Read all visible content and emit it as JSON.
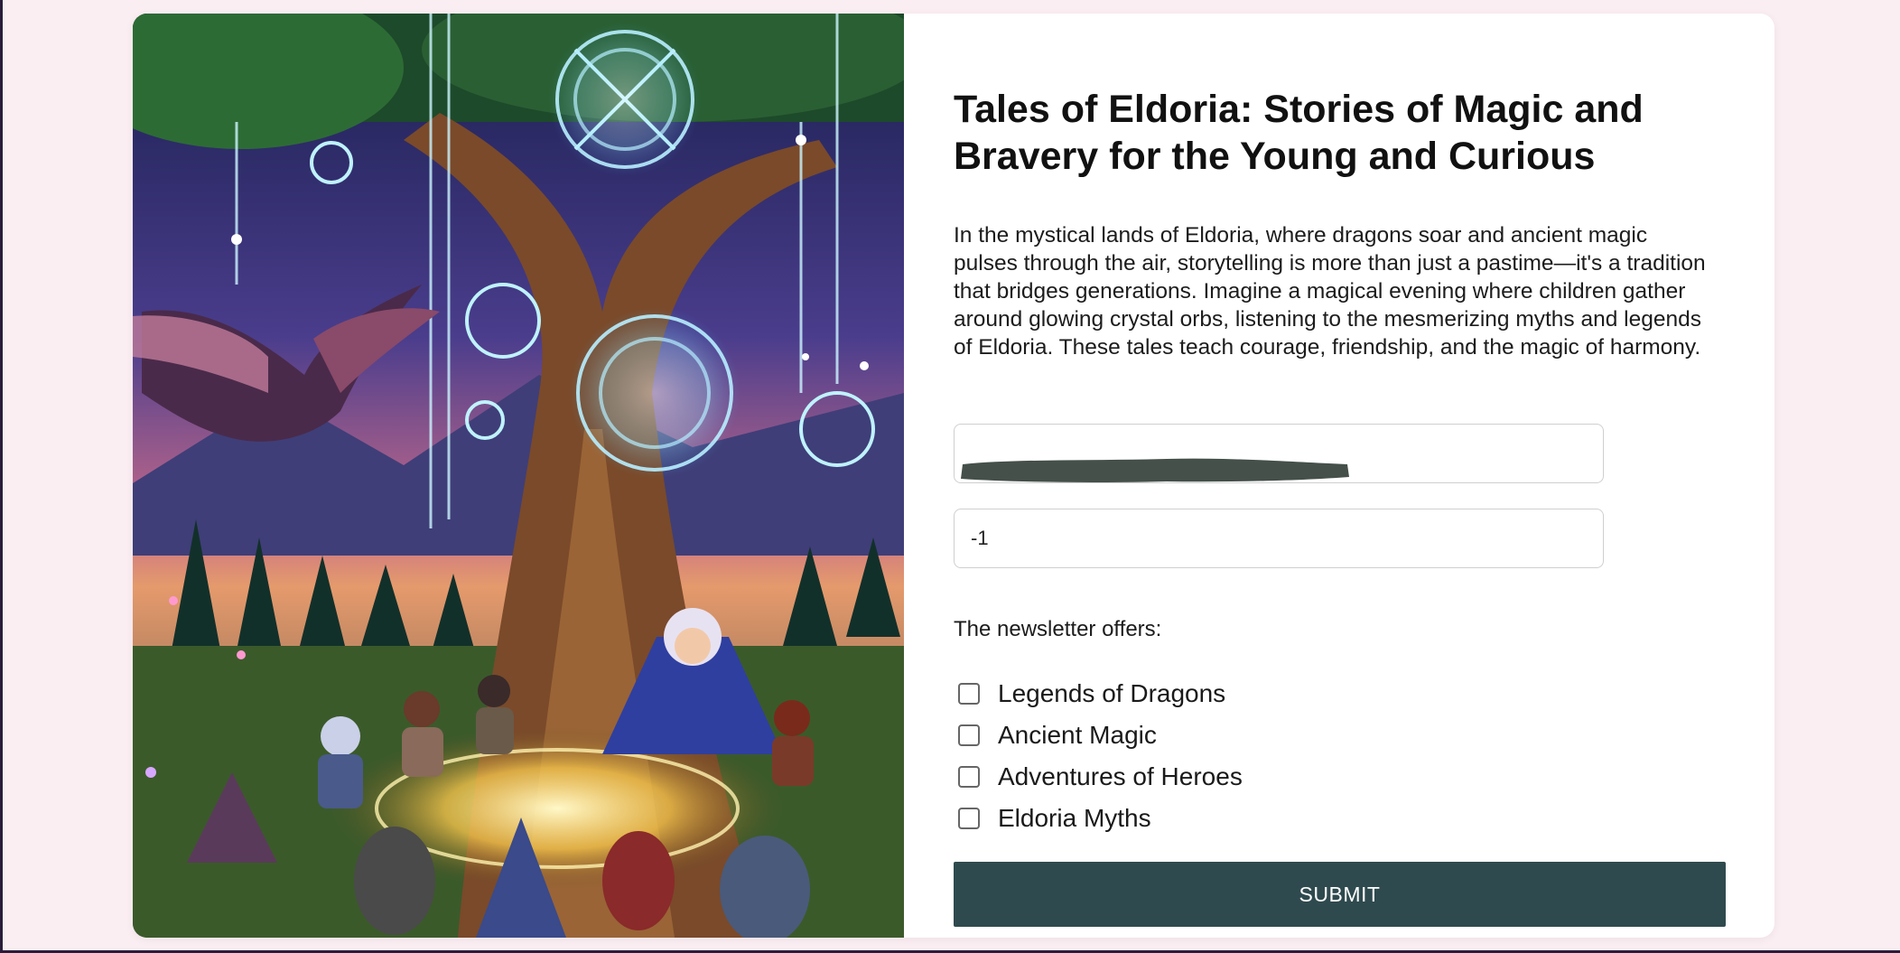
{
  "article": {
    "title": "Tales of Eldoria: Stories of Magic and Bravery for the Young and Curious",
    "description": "In the mystical lands of Eldoria, where dragons soar and ancient magic pulses through the air, storytelling is more than just a pastime—it's a tradition that bridges generations. Imagine a magical evening where children gather around glowing crystal orbs, listening to the mesmerizing myths and legends of Eldoria. These tales teach courage, friendship, and the magic of harmony."
  },
  "form": {
    "name_field": {
      "value": ""
    },
    "number_field": {
      "value": "-1"
    },
    "offers_label": "The newsletter offers:",
    "options": [
      {
        "label": "Legends of Dragons",
        "checked": false
      },
      {
        "label": "Ancient Magic",
        "checked": false
      },
      {
        "label": "Adventures of Heroes",
        "checked": false
      },
      {
        "label": "Eldoria Myths",
        "checked": false
      }
    ],
    "submit_label": "SUBMIT"
  },
  "colors": {
    "page_background": "#fbeef2",
    "submit_background": "#2f4a4e",
    "redaction": "#45504a"
  },
  "illustration": {
    "icons": [
      "dragon-icon",
      "tree-icon",
      "rune-circle-icon",
      "storyteller-icon"
    ]
  }
}
